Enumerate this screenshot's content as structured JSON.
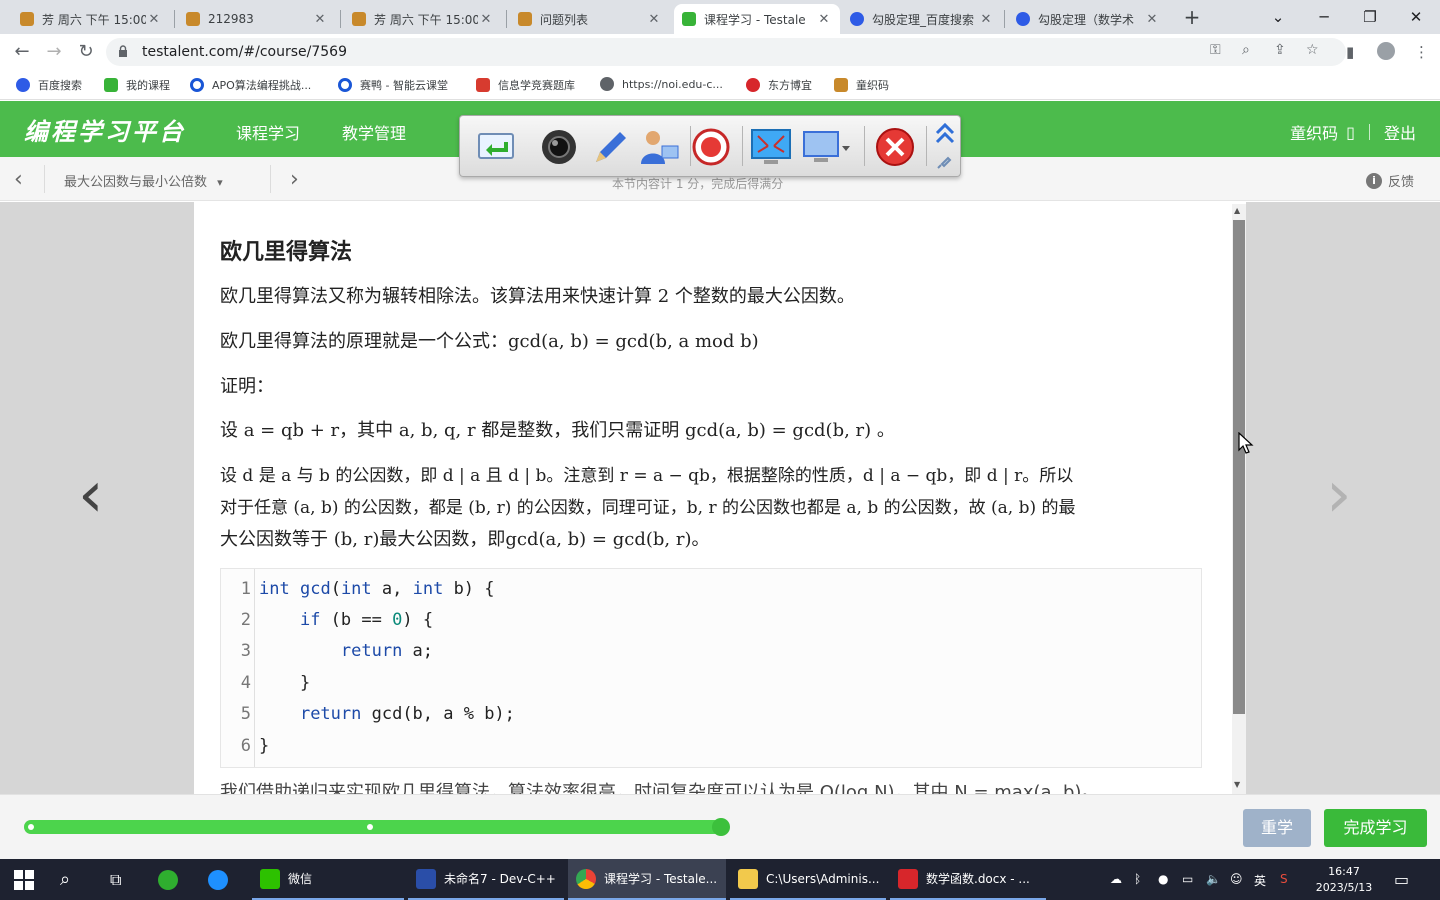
{
  "browser": {
    "tabs": [
      {
        "title": "芳 周六 下午 15:00",
        "active": false
      },
      {
        "title": "212983",
        "active": false
      },
      {
        "title": "芳 周六 下午 15:00",
        "active": false
      },
      {
        "title": "问题列表",
        "active": false
      },
      {
        "title": "课程学习 - Testale",
        "active": true
      },
      {
        "title": "勾股定理_百度搜索",
        "active": false
      },
      {
        "title": "勾股定理（数学术",
        "active": false
      }
    ],
    "new_tab": "+",
    "url": "testalent.com/#/course/7569",
    "bookmarks": [
      "百度搜索",
      "我的课程",
      "APO算法编程挑战...",
      "赛鸭 - 智能云课堂",
      "信息学竞赛题库",
      "https://noi.edu-c...",
      "东方博宜",
      "童织码"
    ],
    "colors": {
      "chrome_bg": "#dee1e6",
      "brand_green": "#4cbb4c"
    }
  },
  "site": {
    "logo": "编程学习平台",
    "nav": [
      "课程学习",
      "教学管理"
    ],
    "user": "童织码",
    "user_glyph": "▯",
    "logout": "登出"
  },
  "subheader": {
    "prev": "‹",
    "next": "›",
    "lesson": "最大公因数与最小公倍数",
    "caret": "▾",
    "note": "本节内容计 1 分，完成后得满分",
    "feedback": "反馈",
    "feedback_icon": "i"
  },
  "nav_arrows": {
    "prev": "‹",
    "next": "›"
  },
  "article": {
    "title": "欧几里得算法",
    "lines": [
      "欧几里得算法又称为辗转相除法。该算法用来快速计算 2 个整数的最大公因数。",
      "欧几里得算法的原理就是一个公式：gcd(a, b) = gcd(b, a mod b)",
      "证明：",
      "设 a = qb + r，其中 a, b, q, r 都是整数，我们只需证明 gcd(a, b) = gcd(b, r) 。",
      "设 d 是 a 与 b 的公因数，即 d | a 且 d | b。注意到 r = a − qb，根据整除的性质，d | a − qb，即 d | r。所以",
      "对于任意 (a, b) 的公因数，都是 (b, r) 的公因数，同理可证，b, r 的公因数也都是 a, b 的公因数，故 (a, b) 的最",
      "大公因数等于 (b, r)最大公因数，即gcd(a, b) = gcd(b, r)。"
    ],
    "code": [
      {
        "n": "1",
        "text": "int gcd(int a, int b) {"
      },
      {
        "n": "2",
        "text": "    if (b == 0) {"
      },
      {
        "n": "3",
        "text": "        return a;"
      },
      {
        "n": "4",
        "text": "    }"
      },
      {
        "n": "5",
        "text": "    return gcd(b, a % b);"
      },
      {
        "n": "6",
        "text": "}"
      }
    ],
    "cut_line": "我们借助递归来实现欧几里得算法，算法效率很高，时间复杂度可以认为是 O(log N)，其中 N = max(a, b)。"
  },
  "progress": {
    "fraction": 0.995,
    "midpoint_fraction": 0.49
  },
  "buttons": {
    "relearn": "重学",
    "finish": "完成学习"
  },
  "taskbar": {
    "apps": [
      {
        "label": "微信"
      },
      {
        "label": "未命名7 - Dev-C++"
      },
      {
        "label": "课程学习 - Testale..."
      },
      {
        "label": "C:\\Users\\Adminis..."
      },
      {
        "label": "数学函数.docx - ..."
      }
    ],
    "ime": "英",
    "time": "16:47",
    "date": "2023/5/13"
  }
}
